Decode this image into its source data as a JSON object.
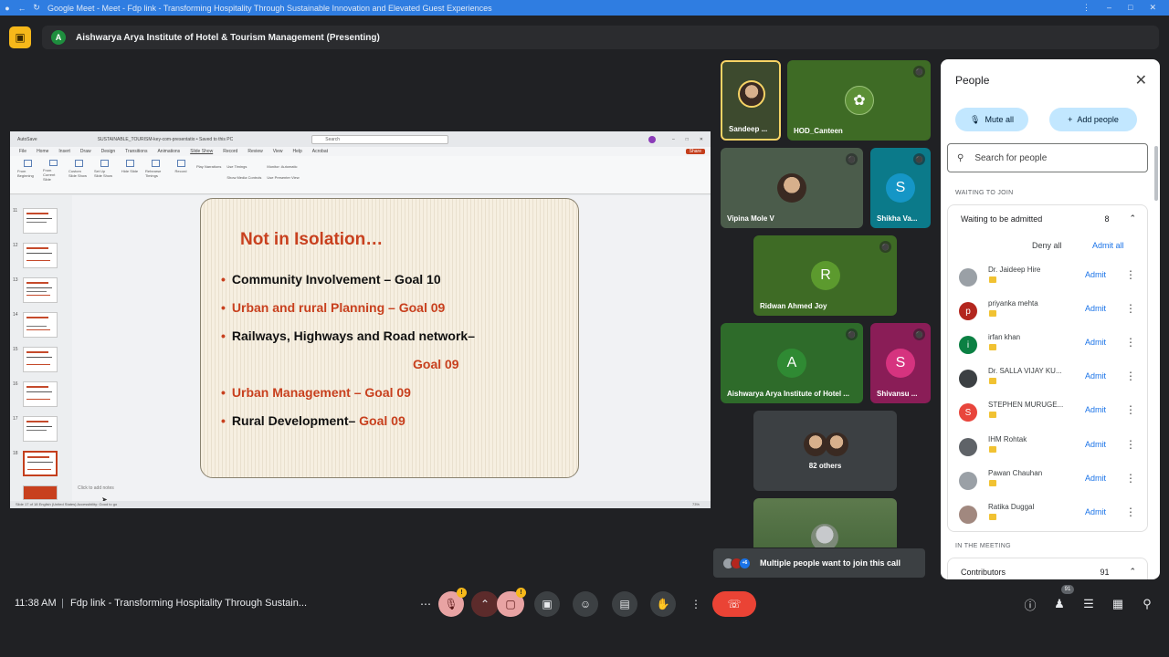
{
  "browser": {
    "tab_title": "Google Meet - Meet - Fdp link - Transforming Hospitality Through Sustainable Innovation and Elevated Guest Experiences"
  },
  "presenting": {
    "avatar_letter": "A",
    "label": "Aishwarya Arya Institute of Hotel & Tourism Management (Presenting)"
  },
  "ppt": {
    "autosave": "AutoSave",
    "file_title": "SUSTAINABLE_TOURISM-key-com-presentatio • Saved to this PC",
    "search_placeholder": "Search",
    "menu": [
      "File",
      "Home",
      "Insert",
      "Draw",
      "Design",
      "Transitions",
      "Animations",
      "Slide Show",
      "Record",
      "Review",
      "View",
      "Help",
      "Acrobat"
    ],
    "share_label": "Share",
    "ribbon": [
      "From Beginning",
      "From Current Slide",
      "Custom Slide Show",
      "Set Up Slide Show",
      "Hide Slide",
      "Rehearse Timings",
      "Record"
    ],
    "ribbon_opts": [
      "Play Narrations",
      "Use Timings",
      "Show Media Controls",
      "Monitor: Automatic",
      "Use Presenter View"
    ],
    "thumb_numbers": [
      "11",
      "12",
      "13",
      "14",
      "15",
      "16",
      "17",
      "18"
    ],
    "notes_placeholder": "Click to add notes",
    "status": "Slide 17 of 18    English (United States)    Accessibility: Good to go",
    "zoom": "73%"
  },
  "slide": {
    "title": "Not in Isolation…",
    "b1": "Community Involvement  – Goal 10",
    "b2": "Urban and rural Planning – Goal 09",
    "b3": "Railways, Highways and Road network–",
    "b3b": "Goal 09",
    "b4": "Urban Management – Goal 09",
    "b5a": "Rural Development– ",
    "b5b": "Goal 09"
  },
  "tiles": {
    "t1": "Sandeep ...",
    "t2": "HOD_Canteen",
    "t3": "Vipina Mole V",
    "t4": "Shikha Va...",
    "t4_letter": "S",
    "t5": "Ridwan Ahmed Joy",
    "t5_letter": "R",
    "t6": "Aishwarya Arya Institute of Hotel ...",
    "t6_letter": "A",
    "t7": "Shivansu ...",
    "t7_letter": "S",
    "t8": "82 others"
  },
  "people": {
    "title": "People",
    "mute_all": "Mute all",
    "add_people": "Add people",
    "search_placeholder": "Search for people",
    "waiting_section": "WAITING TO JOIN",
    "waiting_header": "Waiting to be admitted",
    "waiting_count": "8",
    "deny_all": "Deny all",
    "admit_all": "Admit all",
    "admit_label": "Admit",
    "rows": [
      {
        "name": "Dr. Jaideep Hire",
        "letter": "",
        "color": "#9aa0a6"
      },
      {
        "name": "priyanka mehta",
        "letter": "p",
        "color": "#b3261e"
      },
      {
        "name": "irfan khan",
        "letter": "i",
        "color": "#0b8043"
      },
      {
        "name": "Dr. SALLA VIJAY KU...",
        "letter": "",
        "color": "#3c4043"
      },
      {
        "name": "STEPHEN MURUGE...",
        "letter": "S",
        "color": "#e8453c"
      },
      {
        "name": "IHM Rohtak",
        "letter": "",
        "color": "#5f6368"
      },
      {
        "name": "Pawan Chauhan",
        "letter": "",
        "color": "#9aa0a6"
      },
      {
        "name": "Ratika Duggal",
        "letter": "",
        "color": "#a1887f"
      }
    ],
    "meeting_section": "IN THE MEETING",
    "contributors": "Contributors",
    "contributors_count": "91"
  },
  "toast": {
    "more": "+6",
    "text": "Multiple people want to join this call"
  },
  "bottom": {
    "time": "11:38 AM",
    "separator": "|",
    "meeting_title": "Fdp link - Transforming Hospitality Through Sustain...",
    "participant_count": "91"
  },
  "colors": {
    "accent": "#1a73e8",
    "end_call": "#ea4335",
    "slide_title": "#c8401e"
  }
}
